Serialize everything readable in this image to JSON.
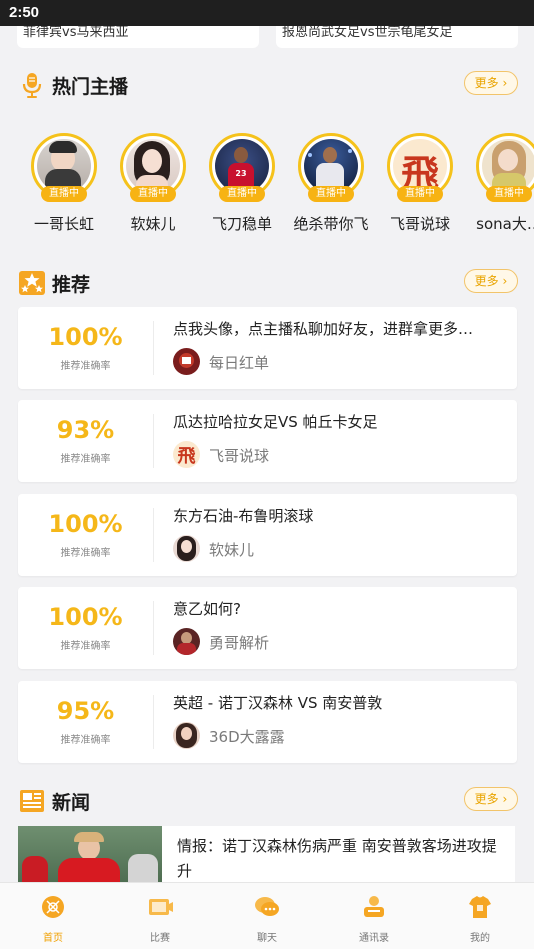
{
  "status_bar": {
    "time": "2:50"
  },
  "top_matches": [
    {
      "text": "菲律宾vs马来西亚"
    },
    {
      "text": "报恩尚武女足vs世宗龟尾女足"
    }
  ],
  "hot_anchors": {
    "title": "热门主播",
    "more_label": "更多",
    "live_label": "直播中",
    "items": [
      {
        "name": "一哥长虹"
      },
      {
        "name": "软妹儿"
      },
      {
        "name": "飞刀稳单"
      },
      {
        "name": "绝杀带你飞"
      },
      {
        "name": "飞哥说球"
      },
      {
        "name": "sona大…"
      }
    ]
  },
  "recommend": {
    "title": "推荐",
    "more_label": "更多",
    "rate_label": "推荐准确率",
    "items": [
      {
        "rate": "100%",
        "title": "点我头像，点主播私聊加好友，进群拿更多…",
        "author": "每日红单"
      },
      {
        "rate": "93%",
        "title": "瓜达拉哈拉女足VS 帕丘卡女足",
        "author": "飞哥说球"
      },
      {
        "rate": "100%",
        "title": "东方石油-布鲁明滚球",
        "author": "软妹儿"
      },
      {
        "rate": "100%",
        "title": "意乙如何?",
        "author": "勇哥解析"
      },
      {
        "rate": "95%",
        "title": "英超 - 诺丁汉森林 VS 南安普敦",
        "author": "36D大露露"
      }
    ]
  },
  "news": {
    "title": "新闻",
    "more_label": "更多",
    "items": [
      {
        "title": "情报：诺丁汉森林伤病严重 南安普敦客场进攻提升"
      }
    ]
  },
  "tabbar": {
    "items": [
      {
        "label": "首页",
        "icon": "home-icon",
        "active": true
      },
      {
        "label": "比赛",
        "icon": "match-icon"
      },
      {
        "label": "聊天",
        "icon": "chat-icon"
      },
      {
        "label": "通讯录",
        "icon": "contacts-icon"
      },
      {
        "label": "我的",
        "icon": "profile-icon"
      }
    ]
  },
  "colors": {
    "accent": "#f5b719",
    "live_badge": "#f7b313",
    "more_border": "#f2c46a"
  }
}
